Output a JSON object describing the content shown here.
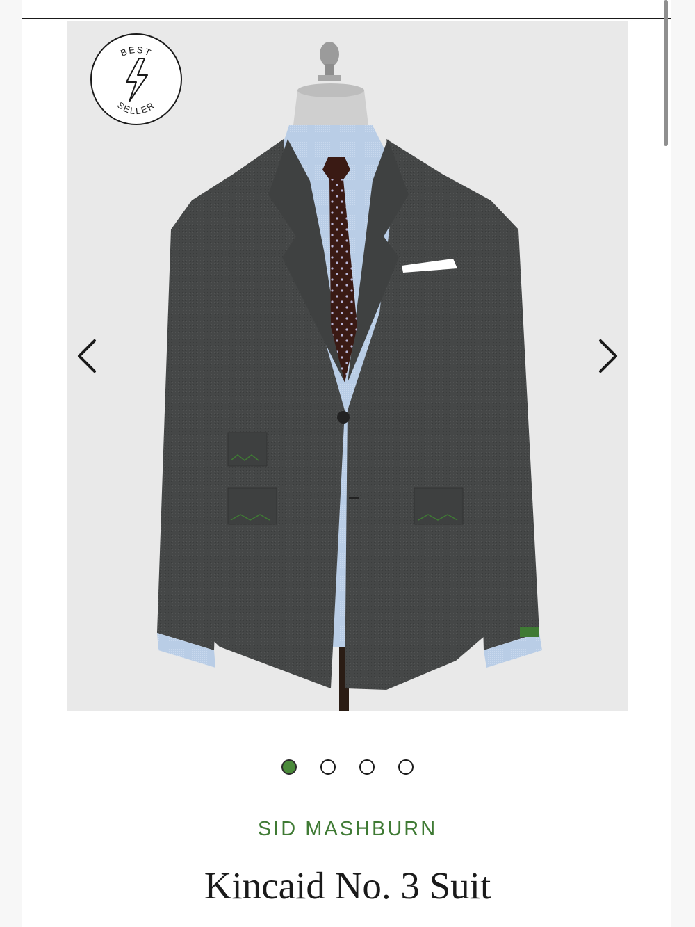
{
  "badge": {
    "top_text": "BEST",
    "bottom_text": "SELLER",
    "icon": "lightning-bolt-icon"
  },
  "gallery": {
    "prev_icon": "chevron-left-icon",
    "next_icon": "chevron-right-icon",
    "image_count": 4,
    "active_index": 0
  },
  "product": {
    "brand": "SID MASHBURN",
    "title": "Kincaid No. 3 Suit"
  },
  "colors": {
    "accent": "#3f7a34",
    "active_dot": "#4a8a3a",
    "suit": "#444646",
    "background": "#e9e9e9"
  }
}
